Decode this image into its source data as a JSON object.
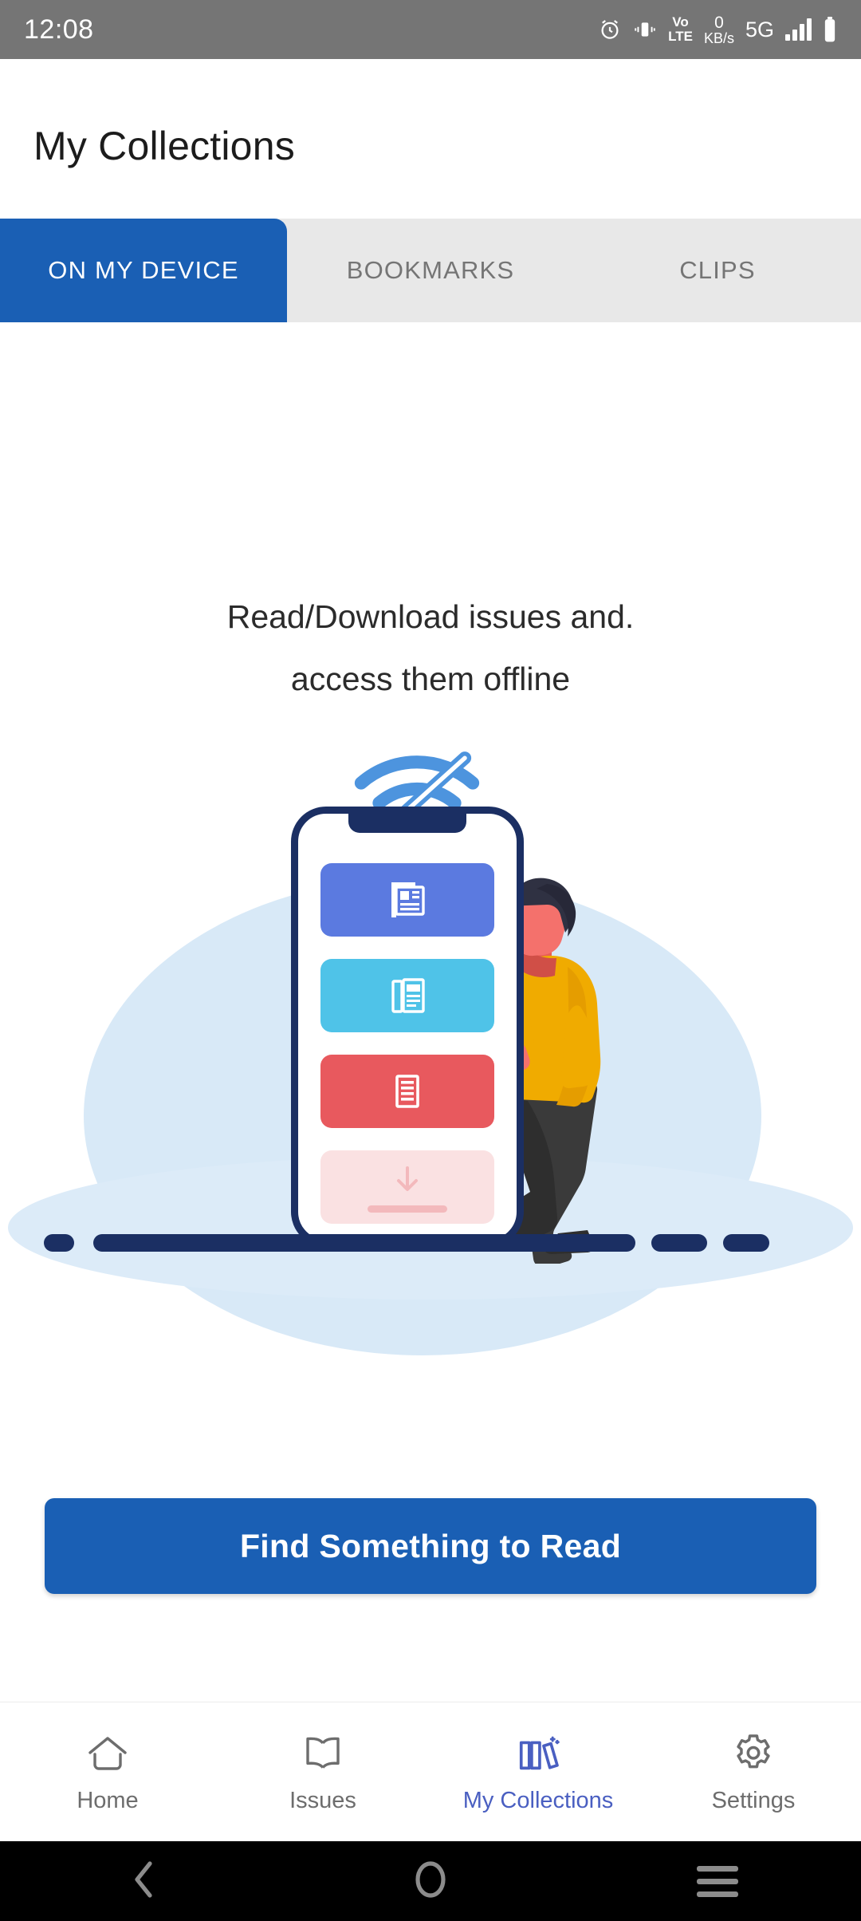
{
  "status_bar": {
    "time": "12:08",
    "data_rate_value": "0",
    "data_rate_unit": "KB/s",
    "volte_top": "Vo",
    "volte_bottom": "LTE",
    "network": "5G",
    "icons": [
      "alarm-icon",
      "vibrate-icon",
      "volte-icon",
      "data-rate-indicator",
      "network-5g-label",
      "signal-bars-icon",
      "battery-icon"
    ],
    "background": "#757575"
  },
  "header": {
    "title": "My Collections"
  },
  "tabs": {
    "items": [
      {
        "label": "ON MY DEVICE",
        "active": true
      },
      {
        "label": "BOOKMARKS",
        "active": false
      },
      {
        "label": "CLIPS",
        "active": false
      }
    ],
    "active_color": "#1a5fb4",
    "inactive_background": "#e8e8e8",
    "inactive_text_color": "#757575"
  },
  "empty_state": {
    "line1": "Read/Download issues and.",
    "line2": "access them offline",
    "illustration": {
      "name": "offline-reading-illustration",
      "wifi_icon": "wifi-off-icon",
      "wifi_color": "#4d94de",
      "backdrop_color": "#d8e9f7",
      "phone_frame_color": "#1b2f63",
      "cards": [
        {
          "name": "newspaper-card",
          "color": "#5b7ae0",
          "icon": "newspaper-icon"
        },
        {
          "name": "magazine-card",
          "color": "#4fc3e8",
          "icon": "magazine-icon"
        },
        {
          "name": "article-card",
          "color": "#e8595e",
          "icon": "article-lines-icon"
        },
        {
          "name": "download-card",
          "color": "#fae1e2",
          "icon": "download-arrow-icon"
        }
      ],
      "person": {
        "name": "person-with-phone",
        "hair_color": "#2f3142",
        "skin_color": "#f4716c",
        "shirt_color": "#f0ab00",
        "pants_color": "#3a3a3a"
      }
    }
  },
  "cta": {
    "label": "Find Something to Read",
    "color": "#1a5fb4"
  },
  "bottom_nav": {
    "active_color": "#4a5fc1",
    "inactive_color": "#6d6d6d",
    "items": [
      {
        "label": "Home",
        "icon": "home-icon",
        "active": false
      },
      {
        "label": "Issues",
        "icon": "open-book-icon",
        "active": false
      },
      {
        "label": "My Collections",
        "icon": "books-stack-icon",
        "active": true
      },
      {
        "label": "Settings",
        "icon": "gear-icon",
        "active": false
      }
    ]
  },
  "android_nav": {
    "items": [
      {
        "name": "back-button",
        "icon": "chevron-left-icon"
      },
      {
        "name": "home-button",
        "icon": "circle-icon"
      },
      {
        "name": "recents-button",
        "icon": "hamburger-icon"
      }
    ],
    "color": "#8c8c8c"
  }
}
